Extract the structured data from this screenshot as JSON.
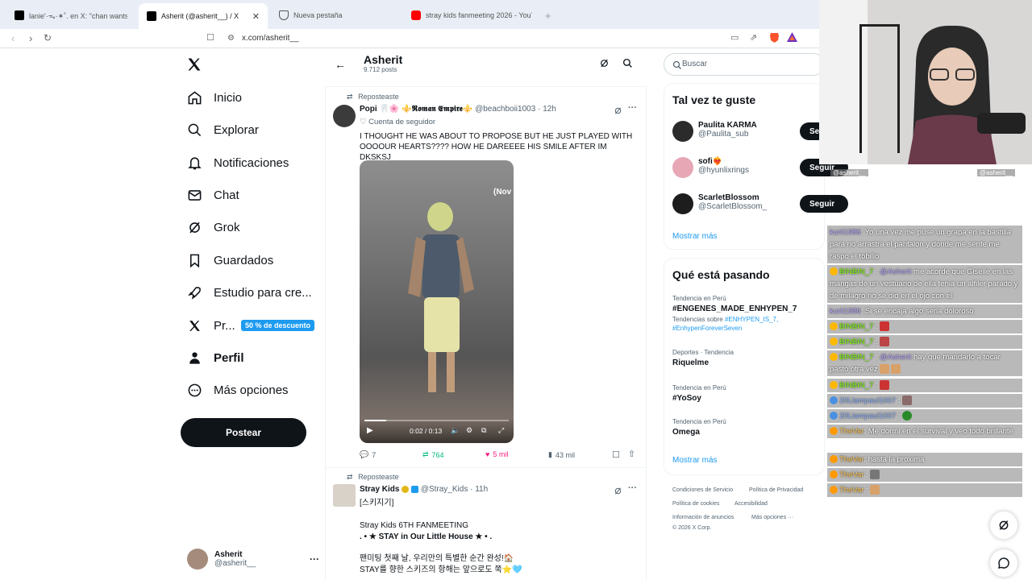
{
  "browser": {
    "tabs": [
      {
        "title": "lanie'·ᯓ·✶˚. en X: \"chan wants y'all"
      },
      {
        "title": "Asherit (@asherit__) / X"
      },
      {
        "title": "Nueva pestaña"
      },
      {
        "title": "stray kids fanmeeting 2026 - YouTub"
      }
    ],
    "url": "x.com/asherit__"
  },
  "sidebar": {
    "items": [
      {
        "label": "Inicio",
        "icon": "home-icon"
      },
      {
        "label": "Explorar",
        "icon": "search-icon"
      },
      {
        "label": "Notificaciones",
        "icon": "bell-icon"
      },
      {
        "label": "Chat",
        "icon": "mail-icon"
      },
      {
        "label": "Grok",
        "icon": "grok-icon"
      },
      {
        "label": "Guardados",
        "icon": "bookmark-icon"
      },
      {
        "label": "Estudio para cre...",
        "icon": "rocket-icon"
      },
      {
        "label": "Pr...",
        "icon": "x-logo-icon"
      },
      {
        "label": "Perfil",
        "icon": "person-icon"
      },
      {
        "label": "Más opciones",
        "icon": "more-circle-icon"
      }
    ],
    "premium_badge": "50 % de descuento",
    "post_button": "Postear",
    "account": {
      "name": "Asherit",
      "handle": "@asherit__"
    }
  },
  "profile_header": {
    "name": "Asherit",
    "posts": "9.712 posts"
  },
  "tweets": [
    {
      "repost_label": "Reposteaste",
      "name": "Popi 🦷🌸 ⚜️𝕽𝖔𝖒𝖆𝖓 𝕰𝖒𝖕𝖎𝖗𝖊⚜️",
      "handle": "@beachboii1003",
      "time": "12h",
      "note": "Cuenta de seguidor",
      "text": "I THOUGHT HE WAS ABOUT TO PROPOSE BUT HE JUST PLAYED WITH OOOOUR HEARTS???? HOW HE DAREEEE HIS SMILE AFTER IM DKSKSJ",
      "video_time": "0:02 / 0:13",
      "video_overlay": "(Nov",
      "replies": "7",
      "reposts": "764",
      "likes": "5 mil",
      "views": "43 mil"
    },
    {
      "repost_label": "Reposteaste",
      "name": "Stray Kids",
      "handle": "@Stray_Kids",
      "time": "11h",
      "lines": [
        "[스키지기]",
        "Stray Kids 6TH FANMEETING",
        ". • ★ STAY in Our Little House ★ • .",
        "팬미팅 첫째 날, 우리만의 특별한 순간 완성!🏠",
        "STAY를 향한 스키즈의 항해는 앞으로도 쭉⭐🩵"
      ]
    }
  ],
  "right": {
    "search_placeholder": "Buscar",
    "who_to_follow": {
      "title": "Tal vez te guste",
      "users": [
        {
          "name": "Paulita KARMA",
          "handle": "@Paulita_sub",
          "button": "Se"
        },
        {
          "name": "sofi❤️‍🔥",
          "handle": "@hyunlixrings",
          "button": "Seguir"
        },
        {
          "name": "ScarletBlossom",
          "handle": "@ScarletBlossom_",
          "button": "Seguir"
        }
      ],
      "show_more": "Mostrar más"
    },
    "trends": {
      "title": "Qué está pasando",
      "items": [
        {
          "meta": "Tendencia en Perú",
          "name": "#ENGENES_MADE_ENHYPEN_7",
          "extra_prefix": "Tendencias sobre",
          "extra_links": "#ENHYPEN_IS_7, #EnhypenForeverSeven"
        },
        {
          "meta": "Deportes · Tendencia",
          "name": "Riquelme"
        },
        {
          "meta": "Tendencia en Perú",
          "name": "#YoSoy"
        },
        {
          "meta": "Tendencia en Perú",
          "name": "Omega"
        }
      ],
      "show_more": "Mostrar más"
    },
    "footer": {
      "links": [
        "Condiciones de Servicio",
        "Política de Privacidad",
        "Política de cookies",
        "Accesibilidad",
        "Información de anuncios",
        "Más opciones ···"
      ],
      "copyright": "© 2026 X Corp."
    }
  },
  "stream": {
    "handle_left": "@asherit__",
    "handle_right": "@asherit__",
    "chat": [
      {
        "user": "kurii1986",
        "msg": ": Yo una vez me puse un grapa en la bastilla para no arrastra el pantalon y donde me sente me raspo el tobillo"
      },
      {
        "user": "BINBIN_7",
        "mention": "@Asherit",
        "msg": " me acorde que Giselle en las mangas de un vestuario de ella tenia un alfiler parado y de milagro no se dio en el ojo con el"
      },
      {
        "user": "kurii1986",
        "msg": ": Si se encaja algo seria doloroso"
      },
      {
        "user": "BINBIN_7",
        "msg": " :"
      },
      {
        "user": "BINBIN_7",
        "msg": " :"
      },
      {
        "user": "BINBIN_7",
        "mention": "@Asherit",
        "msg": " hay que mandarlo a tocar pasto otra vez"
      },
      {
        "user": "BINBIN_7",
        "msg": " :"
      },
      {
        "user": "20Llampaul1007",
        "msg": " :"
      },
      {
        "user": "20Llampaul1007",
        "msg": " :"
      },
      {
        "user": "TheVar",
        "msg": ": Me dormi en el survival y veo todo brillante"
      },
      {
        "user": "TheVar",
        "msg": ": hasta la proxima"
      },
      {
        "user": "TheVar",
        "msg": " :"
      },
      {
        "user": "TheVar",
        "msg": " :"
      }
    ]
  },
  "colors": {
    "accent": "#1d9bf0",
    "like": "#f91880",
    "repost": "#00ba7c",
    "text": "#0f1419",
    "muted": "#536471"
  }
}
